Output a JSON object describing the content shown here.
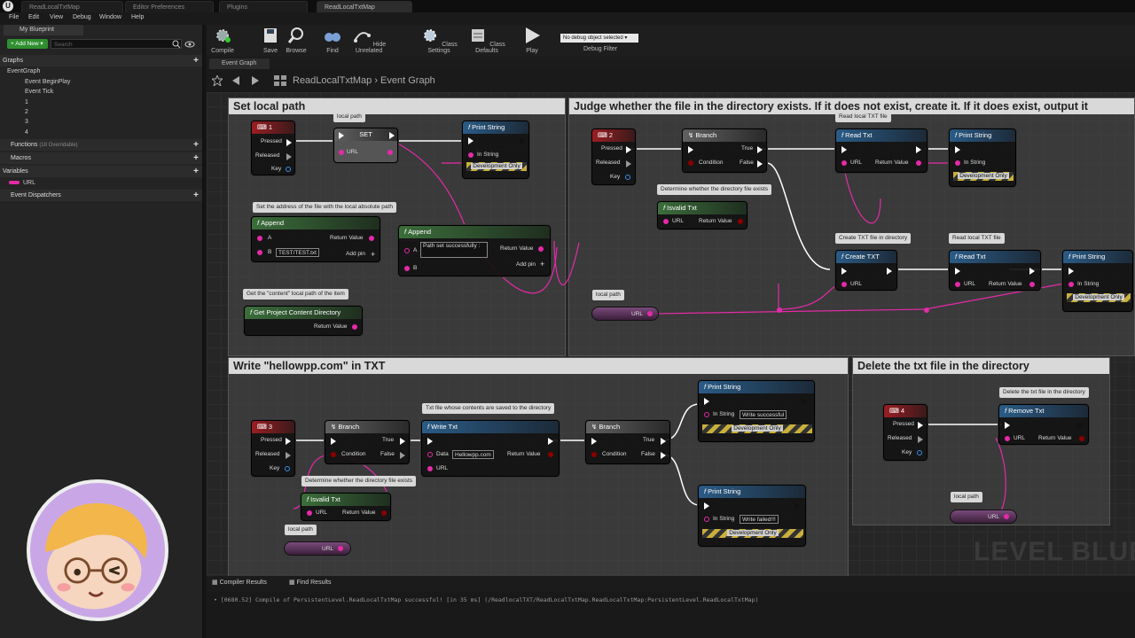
{
  "tabs": [
    "ReadLocalTxtMap",
    "Editor Preferences",
    "Plugins",
    "ReadLocalTxtMap"
  ],
  "menu": [
    "File",
    "Edit",
    "View",
    "Debug",
    "Window",
    "Help"
  ],
  "toolbar": {
    "compile": "Compile",
    "save": "Save",
    "browse": "Browse",
    "find": "Find",
    "hide_unrelated": "Hide Unrelated",
    "class_settings": "Class Settings",
    "class_defaults": "Class Defaults",
    "play": "Play",
    "debug_object": "No debug object selected ▾",
    "debug_filter": "Debug Filter"
  },
  "left_panel": {
    "tab": "My Blueprint",
    "add_new": "+ Add New ▾",
    "search_placeholder": "Search",
    "graphs": "Graphs",
    "event_graph": "EventGraph",
    "events": [
      "Event BeginPlay",
      "Event Tick",
      "1",
      "2",
      "3",
      "4"
    ],
    "functions": "Functions",
    "functions_note": "(18 Overridable)",
    "macros": "Macros",
    "variables": "Variables",
    "var_url": "URL",
    "dispatchers": "Event Dispatchers"
  },
  "graph_tab": "Event Graph",
  "breadcrumb": "ReadLocalTxtMap  ›  Event Graph",
  "comments": {
    "c1": "Set local path",
    "c2": "Judge whether the file in the directory exists. If it does not exist, create it. If it does exist, output it",
    "c3": "Write \"hellowpp.com\" in TXT",
    "c4": "Delete the txt file in the directory"
  },
  "nodes": {
    "key1": "1",
    "key2": "2",
    "key3": "3",
    "key4": "4",
    "pressed": "Pressed",
    "released": "Released",
    "key": "Key",
    "set": "SET",
    "url": "URL",
    "print_string": "Print String",
    "in_string": "In String",
    "dev_only": "Development Only",
    "append": "Append",
    "a": "A",
    "b": "B",
    "return_value": "Return Value",
    "add_pin": "Add pin",
    "b_value": "TEST/TEST.txt",
    "path_set": "Path set successfully  :",
    "get_content_dir": "Get Project Content Directory",
    "branch": "Branch",
    "condition": "Condition",
    "true": "True",
    "false": "False",
    "read_txt": "Read Txt",
    "isvalid_txt": "Isvalid Txt",
    "create_txt": "Create TXT",
    "write_txt": "Write Txt",
    "data": "Data",
    "data_value": "Hellowpp.com",
    "write_ok": "Write successful",
    "write_fail": "Write failed!!!",
    "remove_txt": "Remove Txt"
  },
  "bubbles": {
    "local_path": "local path",
    "set_address": "Set the address of the file with the local absolute path",
    "get_content": "Get the \"content\" local path of the item",
    "read_local_txt_file": "Read local TXT file",
    "determine_exists": "Determine whether the directory file exists",
    "create_txt_dir": "Create TXT file in directory",
    "read_local_txt": "Read local TXT file",
    "txt_saved": "Txt file whose contents are saved to the directory",
    "delete_txt": "Delete the txt file in the directory"
  },
  "watermark": "LEVEL BLUE",
  "bottom_tabs": [
    "Compiler Results",
    "Find Results"
  ],
  "log": "• [0680.52] Compile of PersistentLevel.ReadLocalTxtMap successful! [in 35 ms] (/ReadlocalTXT/ReadLocalTxtMap.ReadLocalTxtMap:PersistentLevel.ReadLocalTxtMap)",
  "colors": {
    "exec": "#ffffff",
    "string_pin": "#e52aa8",
    "bool_pin": "#8b0000",
    "accent": "#2f8f2f"
  }
}
